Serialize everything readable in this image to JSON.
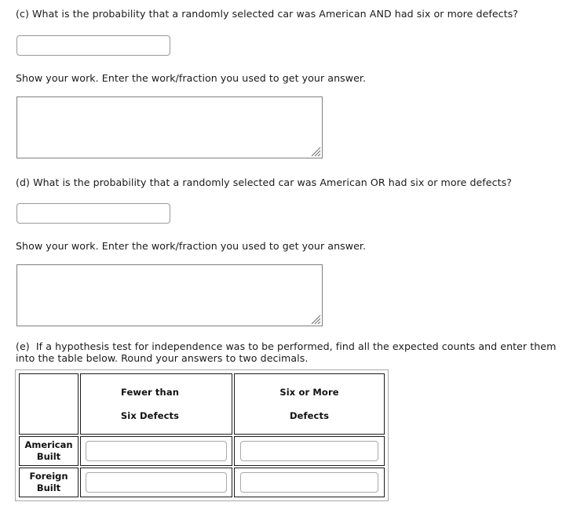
{
  "questions": {
    "c": {
      "prompt": "(c) What is the probability that a randomly selected car was American AND had six or more defects?",
      "answer_value": "",
      "answer_placeholder": "",
      "work_label": "Show your work.  Enter the work/fraction you used to get your answer.",
      "work_value": "",
      "work_placeholder": ""
    },
    "d": {
      "prompt": "(d) What is the probability that a randomly selected car was American OR had six or more defects?",
      "answer_value": "",
      "answer_placeholder": "",
      "work_label": "Show your work.  Enter the work/fraction you used to get your answer.",
      "work_value": "",
      "work_placeholder": ""
    },
    "e": {
      "prompt": "(e)  If a hypothesis test for independence was to be performed, find all the expected counts and enter them into the table below. Round your answers to two decimals."
    }
  },
  "expected_counts_table": {
    "corner_label": "",
    "column_headers": [
      {
        "line1": "Fewer than",
        "line2": "Six Defects"
      },
      {
        "line1": "Six or More",
        "line2": "Defects"
      }
    ],
    "rows": [
      {
        "label_line1": "American",
        "label_line2": "Built",
        "cells": [
          {
            "value": "",
            "placeholder": ""
          },
          {
            "value": "",
            "placeholder": ""
          }
        ]
      },
      {
        "label_line1": "Foreign",
        "label_line2": "Built",
        "cells": [
          {
            "value": "",
            "placeholder": ""
          },
          {
            "value": "",
            "placeholder": ""
          }
        ]
      }
    ]
  },
  "colors": {
    "page_background": "#ffffff",
    "text": "#1a1a1a",
    "input_border": "#999999",
    "textarea_border": "#808080",
    "table_cell_border": "#1c1c1c",
    "table_outer_border": "#a8a8a8"
  },
  "icons": {
    "resize_grip": "resize-grip-icon"
  }
}
